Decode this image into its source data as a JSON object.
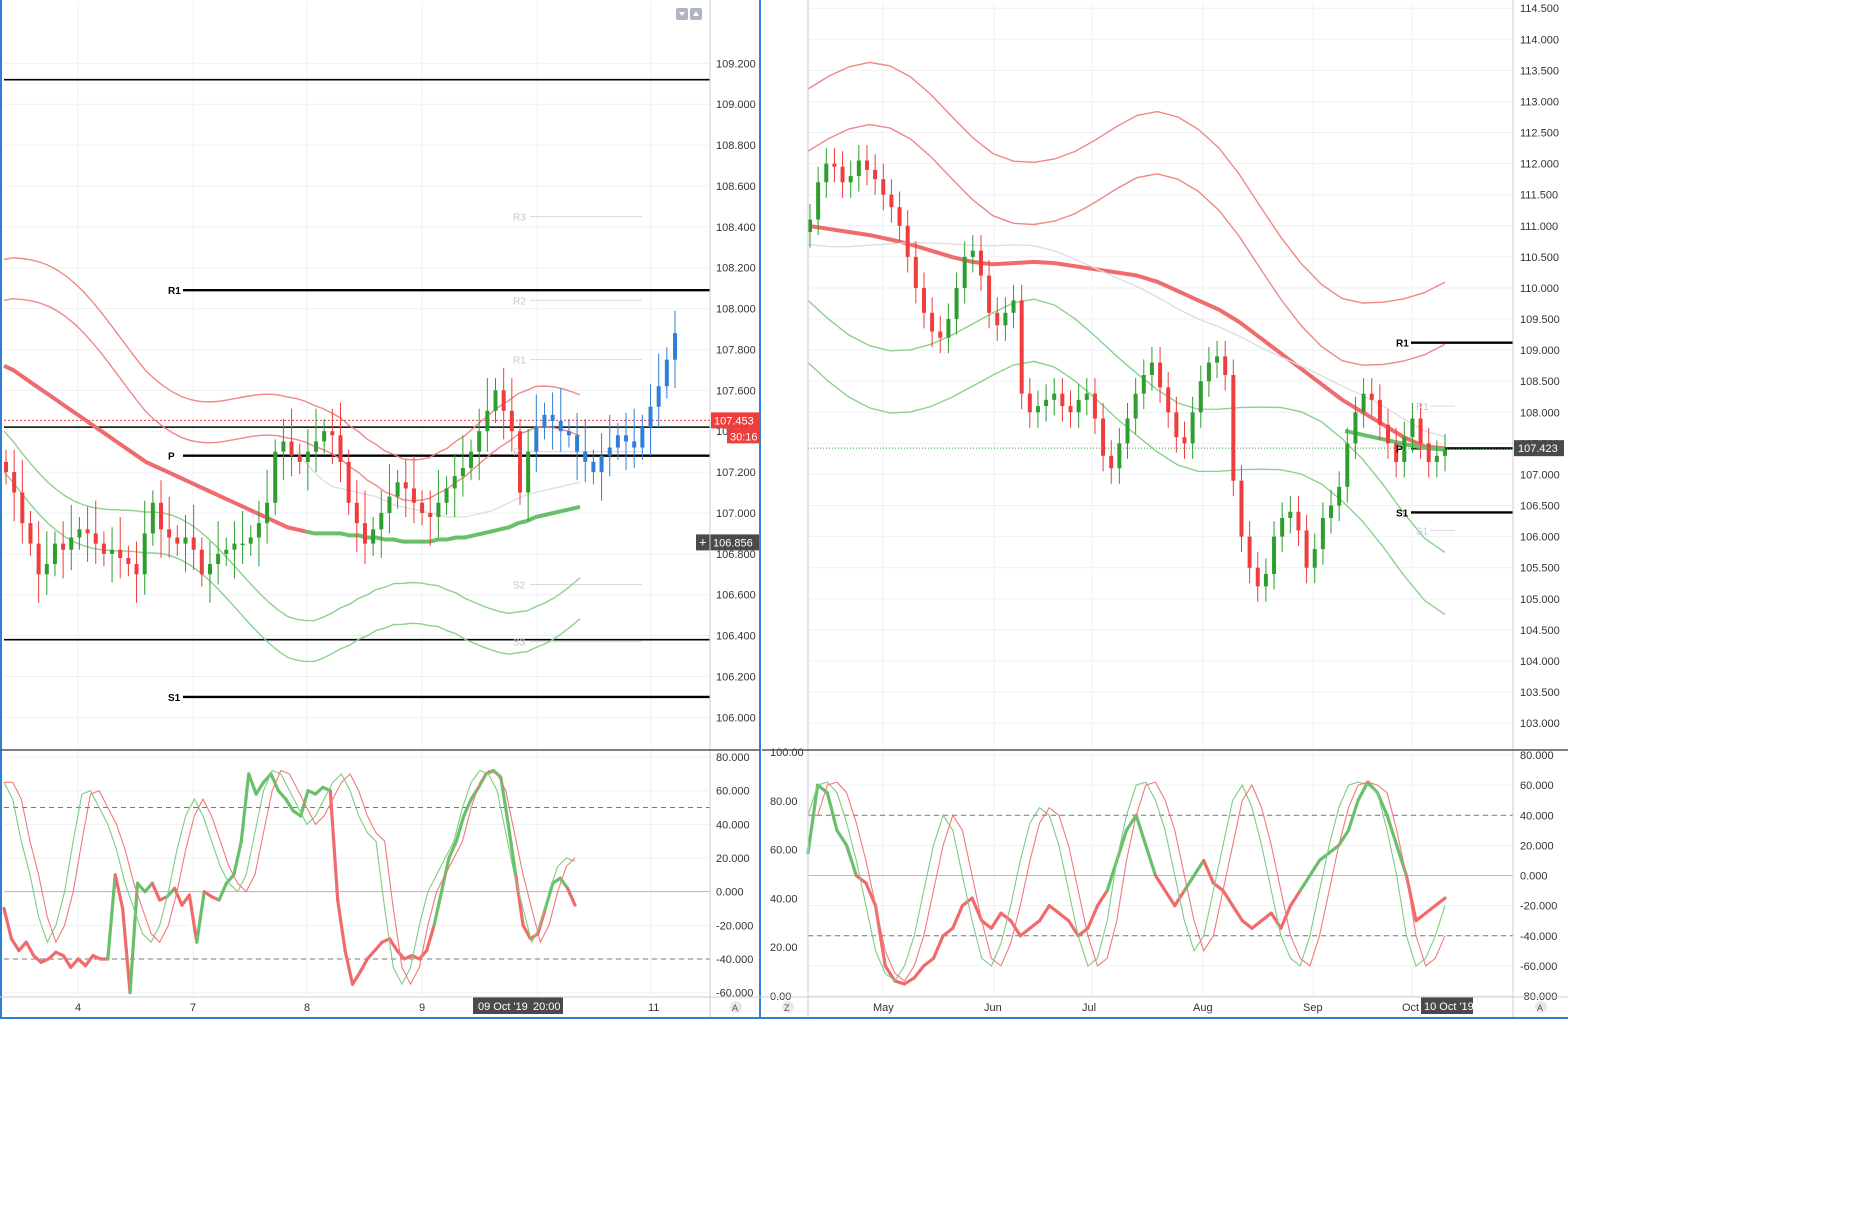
{
  "colors": {
    "up": "#2e9e2e",
    "down": "#ef3c3c",
    "bar_blue": "#2f7fd6",
    "ma_red": "#f06b6b",
    "ma_green": "#6abf6a",
    "band_red": "#f07a7a",
    "band_green": "#7fcc7f",
    "grid": "#eef1f5",
    "frame": "#2f7fd6",
    "price_tag": "#ef3c3c",
    "crosshair_tag": "#4a4a4a",
    "pivot_line": "#000000",
    "osc_mid": "#e29be0"
  },
  "toolbar": {
    "collapse_icon": "chevron-down-icon",
    "expand_icon": "chevron-up-icon",
    "left_bottom_corner": "A",
    "right_bottom_left_corner": "Z",
    "right_bottom_right_corner": "A"
  },
  "left_panel": {
    "price_tag_value": "107.453",
    "price_tag_timer": "30:16",
    "crosshair_value": "106.856",
    "date_tag": "09 Oct '19",
    "time_tag": "20:00",
    "pivot_labels": [
      {
        "label": "R1",
        "value": 108.09
      },
      {
        "label": "P",
        "value": 107.28
      },
      {
        "label": "S1",
        "value": 106.1
      }
    ],
    "faint_pivot_labels": [
      {
        "label": "R3",
        "value": 108.45
      },
      {
        "label": "R2",
        "value": 108.04
      },
      {
        "label": "R1",
        "value": 107.75
      },
      {
        "label": "P",
        "value": 107.3
      },
      {
        "label": "S2",
        "value": 106.65
      },
      {
        "label": "S3",
        "value": 106.37
      }
    ]
  },
  "right_panel": {
    "price_tag_value": "107.423",
    "date_tag": "10 Oct '19",
    "pivot_labels": [
      {
        "label": "R1",
        "value": 109.12
      },
      {
        "label": "P",
        "value": 107.42
      },
      {
        "label": "S1",
        "value": 106.39
      }
    ],
    "faint_pivot_labels": [
      {
        "label": "R1",
        "value": 108.1
      },
      {
        "label": "S1",
        "value": 106.1
      }
    ]
  },
  "chart_data": [
    {
      "id": "left_price",
      "type": "candlestick",
      "timeframe": "hourly",
      "x_tick_labels": [
        "4",
        "7",
        "8",
        "9",
        "11"
      ],
      "y_tick_labels": [
        "106.000",
        "106.200",
        "106.400",
        "106.600",
        "106.800",
        "107.000",
        "107.200",
        "107.400",
        "107.600",
        "107.800",
        "108.000",
        "108.200",
        "108.400",
        "108.600",
        "108.800",
        "109.000",
        "109.200"
      ],
      "ylim": [
        105.85,
        109.5
      ],
      "horizontal_lines": [
        109.12,
        107.42,
        106.38
      ],
      "last_price": 107.453,
      "close": [
        107.2,
        107.1,
        106.95,
        106.85,
        106.7,
        106.75,
        106.85,
        106.82,
        106.88,
        106.92,
        106.9,
        106.85,
        106.8,
        106.82,
        106.78,
        106.75,
        106.7,
        106.9,
        107.05,
        106.92,
        106.88,
        106.85,
        106.88,
        106.82,
        106.7,
        106.75,
        106.8,
        106.82,
        106.85,
        106.85,
        106.88,
        106.95,
        107.05,
        107.3,
        107.35,
        107.28,
        107.25,
        107.3,
        107.35,
        107.4,
        107.38,
        107.25,
        107.05,
        106.95,
        106.85,
        106.92,
        107.0,
        107.08,
        107.15,
        107.12,
        107.05,
        107.0,
        106.98,
        107.05,
        107.12,
        107.18,
        107.22,
        107.3,
        107.4,
        107.5,
        107.6,
        107.5,
        107.4,
        107.1,
        107.3,
        107.42,
        107.48,
        107.45,
        107.4,
        107.38,
        107.3,
        107.25,
        107.2,
        107.28,
        107.32,
        107.38,
        107.35,
        107.32,
        107.42,
        107.52,
        107.62,
        107.75,
        107.88
      ],
      "series": [
        {
          "name": "",
          "kind": "ma_slow",
          "values": [
            107.72,
            107.7,
            107.67,
            107.64,
            107.61,
            107.58,
            107.55,
            107.52,
            107.49,
            107.46,
            107.43,
            107.4,
            107.37,
            107.34,
            107.31,
            107.28,
            107.25,
            107.23,
            107.21,
            107.19,
            107.17,
            107.15,
            107.13,
            107.11,
            107.09,
            107.07,
            107.05,
            107.03,
            107.01,
            106.99,
            106.97,
            106.95,
            106.93,
            106.92,
            106.91,
            106.9,
            106.9,
            106.9,
            106.9,
            106.89,
            106.89,
            106.88,
            106.88,
            106.87,
            106.87,
            106.86,
            106.86,
            106.86,
            106.86,
            106.87,
            106.87,
            106.88,
            106.88,
            106.89,
            106.9,
            106.91,
            106.92,
            106.93,
            106.95,
            106.96,
            106.98,
            106.99,
            107.0,
            107.01,
            107.02,
            107.03
          ]
        },
        {
          "name": "",
          "kind": "ma_fast",
          "values": [
            null,
            null,
            null,
            null,
            null,
            null,
            null,
            null,
            null,
            null,
            null,
            null,
            null,
            null,
            null,
            null,
            null,
            null,
            null,
            null,
            null,
            null,
            null,
            null,
            null,
            null,
            null,
            null,
            null,
            null,
            null,
            null,
            null,
            107.3,
            107.25,
            107.2,
            107.16,
            107.13,
            107.12,
            107.11,
            107.1,
            107.09,
            107.08,
            107.06,
            107.04,
            107.03,
            107.02,
            107.01,
            107.0,
            106.99,
            106.98,
            106.98,
            106.98,
            106.99,
            107.0,
            107.01,
            107.03,
            107.05,
            107.07,
            107.09,
            107.1,
            107.11,
            107.12,
            107.13,
            107.14,
            107.15
          ]
        }
      ]
    },
    {
      "id": "left_oscillator",
      "type": "line",
      "y_tick_labels": [
        "-60.000",
        "-40.000",
        "-20.000",
        "0.000",
        "20.000",
        "40.000",
        "60.000",
        "80.000"
      ],
      "ylim": [
        -62,
        83
      ],
      "levels": [
        50,
        0,
        -40
      ],
      "series": [
        {
          "name": "",
          "values": [
            -10,
            -28,
            -35,
            -30,
            -38,
            -42,
            -40,
            -36,
            -38,
            -45,
            -40,
            -44,
            -38,
            -40,
            -40,
            10,
            -10,
            -60,
            5,
            0,
            5,
            -5,
            -3,
            2,
            -8,
            -2,
            -30,
            0,
            -3,
            -5,
            5,
            10,
            30,
            70,
            58,
            65,
            70,
            60,
            55,
            48,
            45,
            60,
            58,
            62,
            60,
            -5,
            -35,
            -55,
            -48,
            -40,
            -35,
            -30,
            -28,
            -35,
            -40,
            -38,
            -40,
            -35,
            -20,
            0,
            20,
            30,
            45,
            55,
            62,
            70,
            72,
            68,
            40,
            10,
            -20,
            -28,
            -25,
            -10,
            5,
            8,
            2,
            -8
          ]
        },
        {
          "name": "",
          "values": [
            65,
            55,
            30,
            10,
            -15,
            -30,
            -20,
            0,
            30,
            58,
            60,
            50,
            40,
            25,
            5,
            -10,
            -25,
            -30,
            -20,
            0,
            25,
            45,
            55,
            45,
            30,
            15,
            5,
            0,
            10,
            35,
            60,
            72,
            70,
            60,
            50,
            40,
            45,
            55,
            65,
            70,
            60,
            45,
            35,
            30,
            -10,
            -45,
            -55,
            -45,
            -20,
            0,
            10,
            20,
            30,
            50,
            65,
            72,
            70,
            60,
            35,
            10,
            -10,
            -30,
            -20,
            0,
            15,
            20,
            18
          ]
        }
      ]
    },
    {
      "id": "right_price",
      "type": "candlestick",
      "timeframe": "daily",
      "x_tick_labels": [
        "May",
        "Jun",
        "Jul",
        "Aug",
        "Sep",
        "Oct"
      ],
      "y_tick_labels": [
        "103.000",
        "103.500",
        "104.000",
        "104.500",
        "105.000",
        "105.500",
        "106.000",
        "106.500",
        "107.000",
        "107.500",
        "108.000",
        "108.500",
        "109.000",
        "109.500",
        "110.000",
        "110.500",
        "111.000",
        "111.500",
        "112.000",
        "112.500",
        "113.000",
        "113.500",
        "114.000",
        "114.500"
      ],
      "ylim": [
        102.6,
        114.6
      ],
      "last_price": 107.423,
      "close": [
        111.1,
        111.7,
        112.0,
        111.95,
        111.7,
        111.8,
        112.05,
        111.9,
        111.75,
        111.5,
        111.3,
        111.0,
        110.5,
        110.0,
        109.6,
        109.3,
        109.2,
        109.5,
        110.0,
        110.5,
        110.6,
        110.2,
        109.6,
        109.4,
        109.6,
        109.8,
        108.3,
        108.0,
        108.1,
        108.2,
        108.3,
        108.1,
        108.0,
        108.2,
        108.3,
        107.9,
        107.3,
        107.1,
        107.5,
        107.9,
        108.3,
        108.6,
        108.8,
        108.4,
        108.0,
        107.6,
        107.5,
        108.0,
        108.5,
        108.8,
        108.9,
        108.6,
        106.9,
        106.0,
        105.5,
        105.2,
        105.4,
        106.0,
        106.3,
        106.4,
        106.1,
        105.5,
        105.8,
        106.3,
        106.5,
        106.8,
        107.5,
        108.0,
        108.3,
        108.2,
        107.8,
        107.5,
        107.2,
        107.6,
        107.9,
        107.5,
        107.2,
        107.3,
        107.4
      ],
      "series": [
        {
          "name": "",
          "kind": "ma_slow",
          "values": [
            111.0,
            110.95,
            110.9,
            110.85,
            110.78,
            110.7,
            110.6,
            110.5,
            110.42,
            110.38,
            110.4,
            110.42,
            110.4,
            110.35,
            110.3,
            110.25,
            110.2,
            110.1,
            109.95,
            109.8,
            109.65,
            109.45,
            109.2,
            108.95,
            108.7,
            108.45,
            108.2,
            108.0,
            107.8,
            107.6,
            107.45,
            107.42
          ]
        },
        {
          "name": "",
          "kind": "ma_green",
          "values": [
            107.7,
            107.65,
            107.6,
            107.55,
            107.5,
            107.45,
            107.42,
            107.4
          ]
        }
      ]
    },
    {
      "id": "right_oscillator",
      "type": "line",
      "y_tick_labels_left": [
        "0.00",
        "20.00",
        "40.00",
        "60.00",
        "80.00",
        "100.00"
      ],
      "y_tick_labels_right": [
        "-80.000",
        "-60.000",
        "-40.000",
        "-20.000",
        "0.000",
        "20.000",
        "40.000",
        "60.000",
        "80.000"
      ],
      "ylim": [
        -80,
        82
      ],
      "levels": [
        40,
        0,
        -40
      ],
      "series": [
        {
          "name": "",
          "values": [
            15,
            60,
            55,
            30,
            20,
            0,
            -5,
            -20,
            -60,
            -70,
            -72,
            -68,
            -60,
            -55,
            -40,
            -35,
            -20,
            -15,
            -30,
            -35,
            -25,
            -30,
            -40,
            -35,
            -30,
            -20,
            -25,
            -30,
            -40,
            -35,
            -20,
            -10,
            10,
            30,
            40,
            20,
            0,
            -10,
            -20,
            -10,
            0,
            10,
            -5,
            -10,
            -20,
            -30,
            -35,
            -30,
            -25,
            -35,
            -20,
            -10,
            0,
            10,
            15,
            20,
            30,
            50,
            62,
            55,
            40,
            20,
            0,
            -30,
            -25,
            -20,
            -15
          ]
        },
        {
          "name": "",
          "values": [
            40,
            60,
            62,
            55,
            35,
            10,
            -20,
            -50,
            -65,
            -70,
            -60,
            -40,
            -10,
            20,
            40,
            30,
            0,
            -30,
            -55,
            -60,
            -45,
            -20,
            10,
            35,
            45,
            40,
            20,
            -10,
            -40,
            -60,
            -55,
            -30,
            10,
            40,
            60,
            62,
            50,
            30,
            0,
            -30,
            -50,
            -40,
            -10,
            20,
            50,
            60,
            45,
            20,
            -10,
            -40,
            -55,
            -60,
            -40,
            -10,
            20,
            45,
            60,
            62,
            60,
            55,
            30,
            0,
            -40,
            -60,
            -55,
            -40,
            -20
          ]
        }
      ]
    }
  ]
}
